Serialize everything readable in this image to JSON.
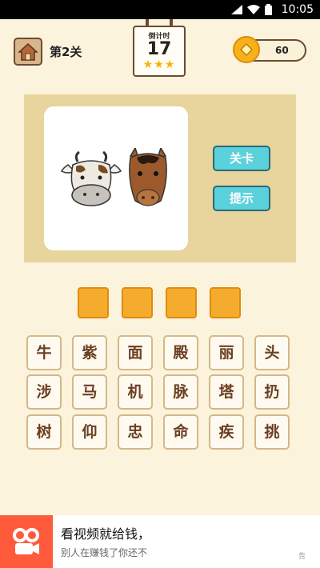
{
  "status_bar": {
    "time": "10:05"
  },
  "header": {
    "level_label": "第2关",
    "timer_label": "倒计时",
    "timer_value": "17",
    "stars": "★★★",
    "star_count": 3,
    "coins": "60"
  },
  "side_buttons": {
    "level": "关卡",
    "hint": "提示"
  },
  "answer_slots": 4,
  "keys": [
    "牛",
    "紫",
    "面",
    "殿",
    "丽",
    "头",
    "涉",
    "马",
    "机",
    "脉",
    "塔",
    "扔",
    "树",
    "仰",
    "忠",
    "命",
    "疾",
    "挑"
  ],
  "ad": {
    "title": "看视频就给钱，",
    "subtitle": "别人在赚钱了你还不",
    "mark": "告"
  },
  "colors": {
    "background": "#fbf3dc",
    "panel": "#e8d49d",
    "slot": "#f5ac2e",
    "side_button": "#5bd1dc",
    "key_text": "#6a3f20"
  },
  "icons": [
    "home-icon",
    "coin-icon",
    "cow-icon",
    "horse-icon",
    "wifi-icon",
    "signal-icon",
    "battery-icon",
    "kuaishou-logo-icon"
  ]
}
